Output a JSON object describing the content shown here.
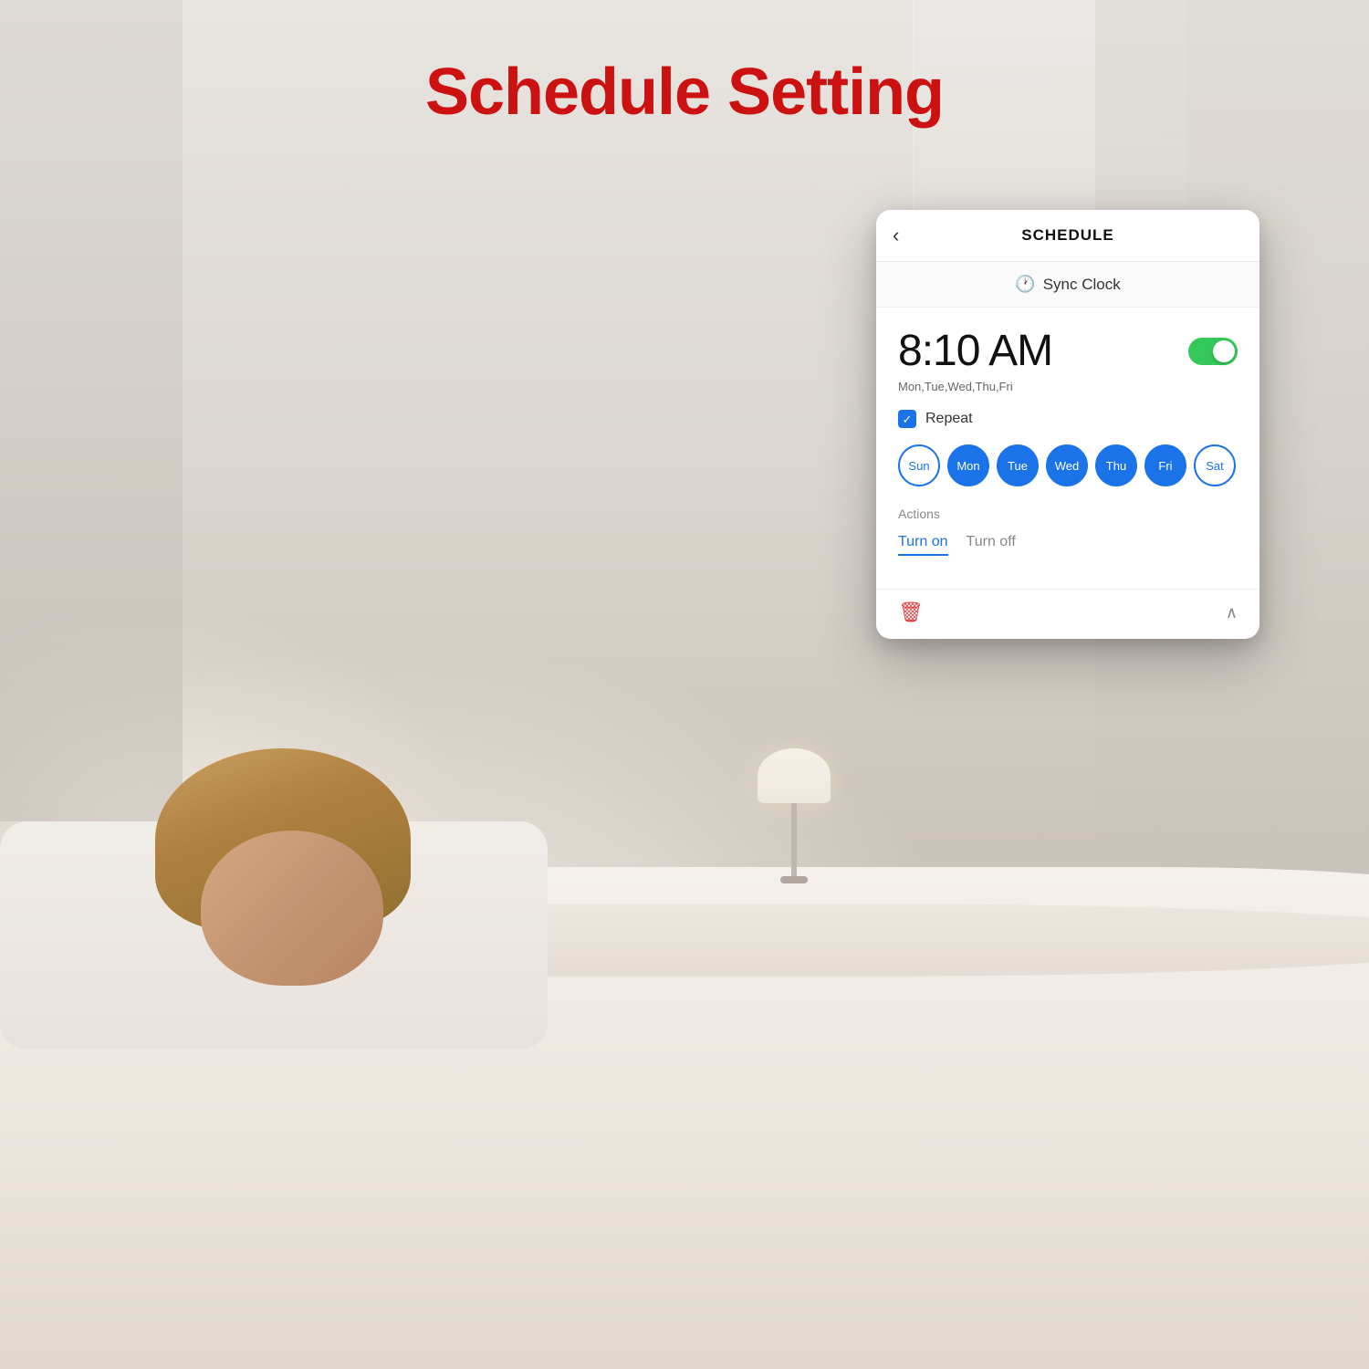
{
  "page": {
    "title": "Schedule Setting",
    "title_color": "#cc1111"
  },
  "app": {
    "header": {
      "back_label": "‹",
      "title": "SCHEDULE"
    },
    "sync_clock": {
      "icon": "🕐",
      "label": "Sync Clock"
    },
    "schedule": {
      "time": "8:10 AM",
      "days_summary": "Mon,Tue,Wed,Thu,Fri",
      "toggle_on": true
    },
    "repeat": {
      "checked": true,
      "label": "Repeat"
    },
    "days": [
      {
        "key": "sun",
        "label": "Sun",
        "active": false
      },
      {
        "key": "mon",
        "label": "Mon",
        "active": true
      },
      {
        "key": "tue",
        "label": "Tue",
        "active": true
      },
      {
        "key": "wed",
        "label": "Wed",
        "active": true
      },
      {
        "key": "thu",
        "label": "Thu",
        "active": true
      },
      {
        "key": "fri",
        "label": "Fri",
        "active": true
      },
      {
        "key": "sat",
        "label": "Sat",
        "active": false
      }
    ],
    "actions": {
      "label": "Actions",
      "turn_on": "Turn on",
      "turn_off": "Turn off"
    },
    "bottom": {
      "delete_icon": "🗑",
      "collapse_icon": "∧"
    }
  }
}
